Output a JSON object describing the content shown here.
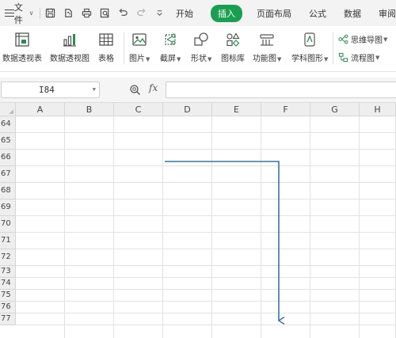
{
  "menubar": {
    "file_label": "文件",
    "tabs": [
      "开始",
      "插入",
      "页面布局",
      "公式",
      "数据",
      "审阅"
    ],
    "active_tab": "插入"
  },
  "ribbon": {
    "items": [
      {
        "label": "数据透视表",
        "icon": "pivot-table-icon",
        "has_caret": false
      },
      {
        "label": "数据透视图",
        "icon": "pivot-chart-icon",
        "has_caret": false
      },
      {
        "label": "表格",
        "icon": "table-icon",
        "has_caret": false
      },
      {
        "label": "图片",
        "icon": "picture-icon",
        "has_caret": true
      },
      {
        "label": "截屏",
        "icon": "screenshot-icon",
        "has_caret": true
      },
      {
        "label": "形状",
        "icon": "shapes-icon",
        "has_caret": true
      },
      {
        "label": "图标库",
        "icon": "icon-library-icon",
        "has_caret": false
      },
      {
        "label": "功能图",
        "icon": "function-chart-icon",
        "has_caret": true
      },
      {
        "label": "学科图形",
        "icon": "subject-graphic-icon",
        "has_caret": true
      }
    ],
    "small_items": [
      {
        "label": "思维导图",
        "icon": "mind-map-icon"
      },
      {
        "label": "流程图",
        "icon": "flowchart-icon"
      }
    ]
  },
  "formula_bar": {
    "name_box": "I84",
    "fx_label": "fx",
    "formula_value": ""
  },
  "sheet": {
    "columns": [
      "A",
      "B",
      "C",
      "D",
      "E",
      "F",
      "G",
      "H"
    ],
    "rows": [
      "64",
      "65",
      "66",
      "67",
      "68",
      "69",
      "70",
      "71",
      "72",
      "73",
      "74",
      "75",
      "76",
      "77"
    ]
  },
  "colors": {
    "accent_green": "#1a9f52",
    "arrow_blue": "#41719c"
  }
}
